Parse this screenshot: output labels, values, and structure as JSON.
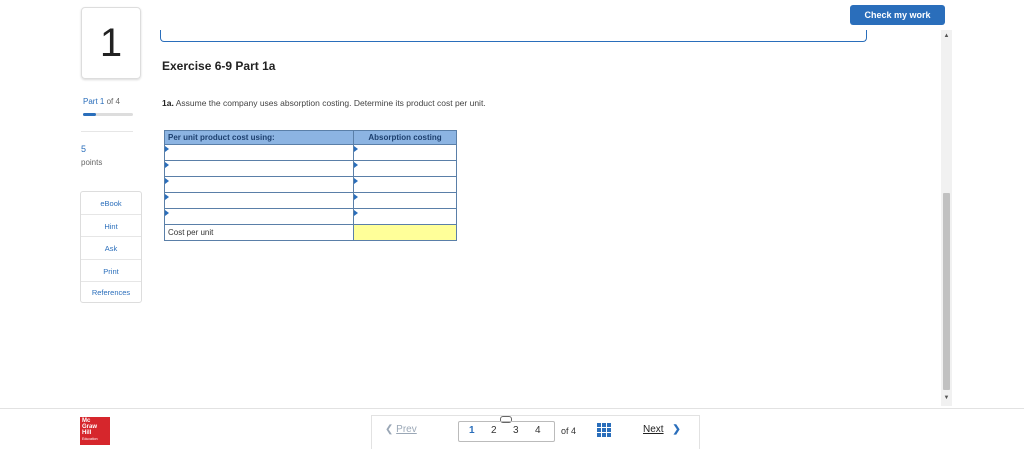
{
  "question": {
    "number": "1",
    "part_text": "Part 1",
    "part_of": "of 4",
    "progress": 0.25,
    "points_value": "5",
    "points_label": "points"
  },
  "tools": [
    "eBook",
    "Hint",
    "Ask",
    "Print",
    "References"
  ],
  "header": {
    "check_button": "Check my work"
  },
  "exercise": {
    "title": "Exercise 6-9 Part 1a",
    "prompt_label": "1a.",
    "prompt_text": "Assume the company uses absorption costing. Determine its product cost per unit."
  },
  "table": {
    "col1_header": "Per unit product cost using:",
    "col2_header": "Absorption costing",
    "input_rows": 5,
    "total_label": "Cost per unit",
    "colors": {
      "header_bg": "#8cb4e2",
      "answer_cell": "#ffff99"
    }
  },
  "footer": {
    "prev_label": "Prev",
    "pages": [
      "1",
      "2",
      "3",
      "4"
    ],
    "current_page": "1",
    "of_text": "of 4",
    "next_label": "Next"
  },
  "logo": {
    "line1": "Mc",
    "line2": "Graw",
    "line3": "Hill",
    "line4": "Education"
  },
  "icons": [
    "grid-icon",
    "link-icon",
    "chevron-left-icon",
    "chevron-right-icon",
    "scroll-up-icon",
    "scroll-down-icon"
  ],
  "accent_color": "#2a6ebb"
}
